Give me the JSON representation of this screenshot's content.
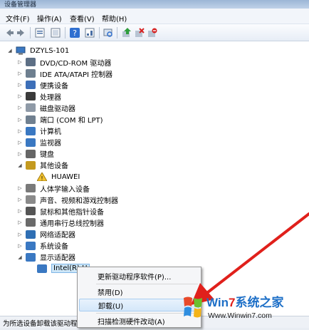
{
  "window": {
    "title": "设备管理器"
  },
  "menu": [
    "文件(F)",
    "操作(A)",
    "查看(V)",
    "帮助(H)"
  ],
  "toolbar": {
    "icons": [
      "back-icon",
      "forward-icon",
      "properties-icon",
      "view-icon",
      "help-icon",
      "show-icon",
      "scan-icon",
      "update-driver-icon",
      "uninstall-icon",
      "disable-icon"
    ]
  },
  "tree": {
    "root": "DZYLS-101",
    "items": [
      {
        "label": "DVD/CD-ROM 驱动器",
        "icon": "dvd-icon",
        "color": "#5d6f85"
      },
      {
        "label": "IDE ATA/ATAPI 控制器",
        "icon": "ide-controller-icon",
        "color": "#6e7f8f"
      },
      {
        "label": "便携设备",
        "icon": "portable-device-icon",
        "color": "#3d6fb8"
      },
      {
        "label": "处理器",
        "icon": "processor-icon",
        "color": "#3b3b3b"
      },
      {
        "label": "磁盘驱动器",
        "icon": "disk-drive-icon",
        "color": "#8f9aa7"
      },
      {
        "label": "端口 (COM 和 LPT)",
        "icon": "port-icon",
        "color": "#708090"
      },
      {
        "label": "计算机",
        "icon": "computer-icon",
        "color": "#3a78c2"
      },
      {
        "label": "监视器",
        "icon": "monitor-icon",
        "color": "#3a78c2"
      },
      {
        "label": "键盘",
        "icon": "keyboard-icon",
        "color": "#666666"
      },
      {
        "label": "其他设备",
        "icon": "other-devices-icon",
        "color": "#c49a1f"
      },
      {
        "label": "HUAWEI",
        "icon": "unknown-device-warning-icon",
        "color": "#e0b531",
        "child": true
      },
      {
        "label": "人体学输入设备",
        "icon": "hid-icon",
        "color": "#7a7a7a"
      },
      {
        "label": "声音、视频和游戏控制器",
        "icon": "sound-icon",
        "color": "#8a8a8a"
      },
      {
        "label": "鼠标和其他指针设备",
        "icon": "mouse-icon",
        "color": "#555555"
      },
      {
        "label": "通用串行总线控制器",
        "icon": "usb-icon",
        "color": "#6a6a6a"
      },
      {
        "label": "网络适配器",
        "icon": "network-adapter-icon",
        "color": "#2f6fb4"
      },
      {
        "label": "系统设备",
        "icon": "system-device-icon",
        "color": "#3a78c2"
      },
      {
        "label": "显示适配器",
        "icon": "display-adapter-icon",
        "color": "#3a78c2"
      },
      {
        "label": "Intel(R) H",
        "icon": "display-device-icon",
        "color": "#3a78c2",
        "child": true,
        "selected": true
      }
    ]
  },
  "context_menu": {
    "items": [
      "更新驱动程序软件(P)...",
      "禁用(D)",
      "卸载(U)",
      "扫描检测硬件改动(A)"
    ],
    "highlighted": "卸载(U)"
  },
  "status": {
    "text": "为所选设备卸载该驱动程"
  },
  "watermark": {
    "brand_a": "Win",
    "brand_b": "7",
    "brand_c": "系统之家",
    "url": "Www.Winwin7.com"
  },
  "colors": {
    "accent": "#3399ff",
    "arrow": "#e0201b",
    "selection": "#cde6f7"
  }
}
